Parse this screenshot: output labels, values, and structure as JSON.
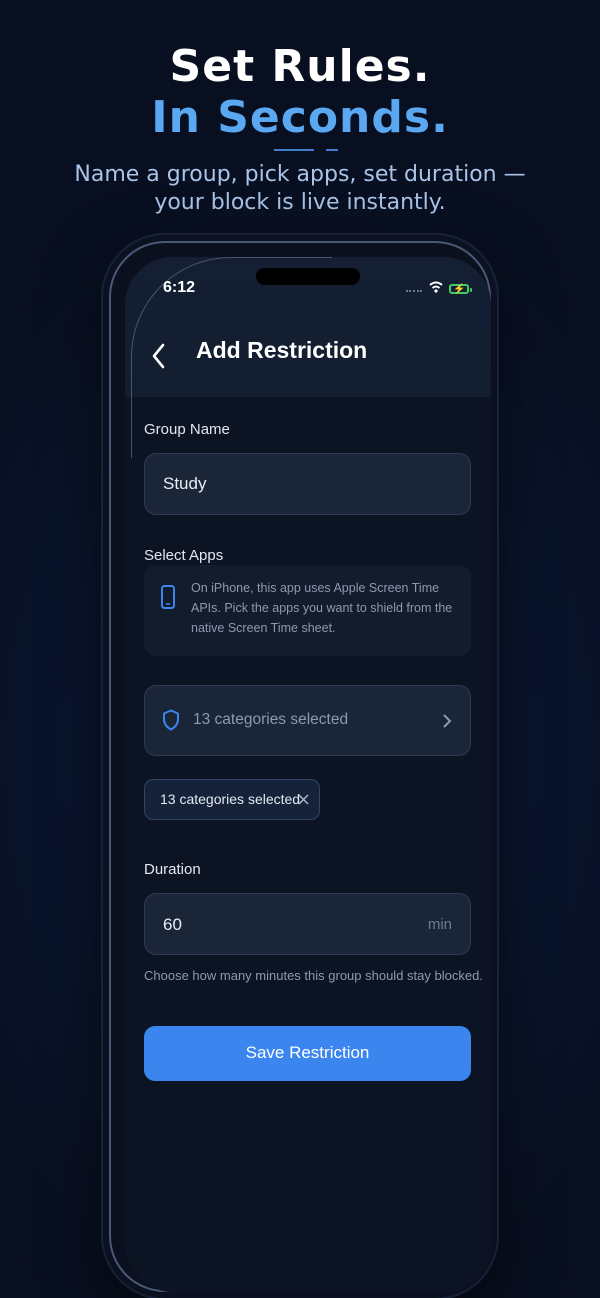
{
  "hero": {
    "line1": "Set Rules.",
    "line2": "In Seconds.",
    "subtitle_line1": "Name a group, pick apps, set duration —",
    "subtitle_line2": "your block is live instantly."
  },
  "status_bar": {
    "time": "6:12"
  },
  "nav": {
    "title": "Add Restriction",
    "back_icon": "chevron-left-icon"
  },
  "form": {
    "group_name_label": "Group Name",
    "group_name_value": "Study",
    "select_apps_label": "Select Apps",
    "info_text": "On iPhone, this app uses Apple Screen Time APIs. Pick the apps you want to shield from the native Screen Time sheet.",
    "picker_text": "13 categories selected",
    "chip_text": "13 categories selected",
    "duration_label": "Duration",
    "duration_value": "60",
    "duration_unit": "min",
    "duration_helper": "Choose how many minutes this group should stay blocked.",
    "save_label": "Save Restriction"
  },
  "colors": {
    "accent": "#3a86ee",
    "headline_blue": "#5aa8f2",
    "battery_green": "#3fcf5f"
  }
}
